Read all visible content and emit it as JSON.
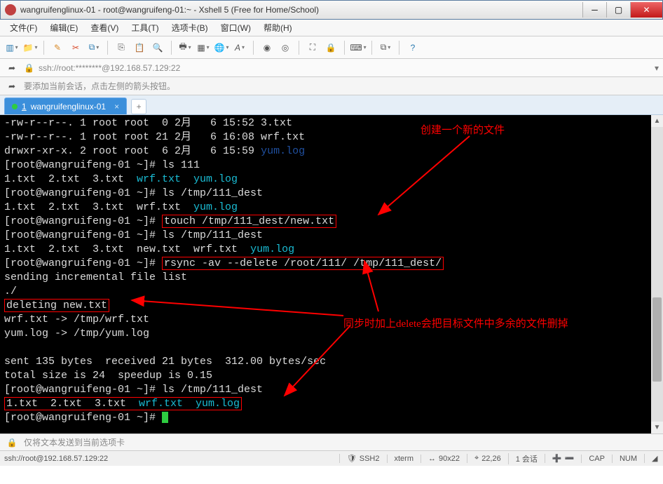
{
  "window": {
    "title": "wangruifenglinux-01 - root@wangruifeng-01:~ - Xshell 5 (Free for Home/School)"
  },
  "menu": {
    "file": "文件(F)",
    "edit": "编辑(E)",
    "view": "查看(V)",
    "tools": "工具(T)",
    "tabs": "选项卡(B)",
    "window": "窗口(W)",
    "help": "帮助(H)"
  },
  "address": {
    "url": "ssh://root:********@192.168.57.129:22"
  },
  "hint": {
    "text": "要添加当前会话，点击左侧的箭头按钮。"
  },
  "tab": {
    "index": "1",
    "label": "wangruifenglinux-01"
  },
  "terminal_lines": [
    {
      "segs": [
        {
          "t": "-rw-r--r--. 1 root root  0 2月   6 15:52 3.txt"
        }
      ]
    },
    {
      "segs": [
        {
          "t": "-rw-r--r--. 1 root root 21 2月   6 16:08 wrf.txt"
        }
      ]
    },
    {
      "segs": [
        {
          "t": "drwxr-xr-x. 2 root root  6 2月   6 15:59 "
        },
        {
          "t": "yum.log",
          "cls": "darkblue"
        }
      ]
    },
    {
      "segs": [
        {
          "t": "[root@wangruifeng-01 ~]# ls 111"
        }
      ]
    },
    {
      "segs": [
        {
          "t": "1.txt  2.txt  3.txt  "
        },
        {
          "t": "wrf.txt  yum.log",
          "cls": "cyan"
        }
      ]
    },
    {
      "segs": [
        {
          "t": "[root@wangruifeng-01 ~]# ls /tmp/111_dest"
        }
      ]
    },
    {
      "segs": [
        {
          "t": "1.txt  2.txt  3.txt  wrf.txt  "
        },
        {
          "t": "yum.log",
          "cls": "cyan"
        }
      ]
    },
    {
      "segs": [
        {
          "t": "[root@wangruifeng-01 ~]# "
        },
        {
          "t": "touch /tmp/111_dest/new.txt",
          "box": true
        }
      ]
    },
    {
      "segs": [
        {
          "t": "[root@wangruifeng-01 ~]# ls /tmp/111_dest"
        }
      ]
    },
    {
      "segs": [
        {
          "t": "1.txt  2.txt  3.txt  new.txt  wrf.txt  "
        },
        {
          "t": "yum.log",
          "cls": "cyan"
        }
      ]
    },
    {
      "segs": [
        {
          "t": "[root@wangruifeng-01 ~]# "
        },
        {
          "t": "rsync -av --delete /root/111/ /tmp/111_dest/",
          "box": true
        }
      ]
    },
    {
      "segs": [
        {
          "t": "sending incremental file list"
        }
      ]
    },
    {
      "segs": [
        {
          "t": "./"
        }
      ]
    },
    {
      "segs": [
        {
          "t": "deleting new.txt",
          "box": true
        }
      ]
    },
    {
      "segs": [
        {
          "t": "wrf.txt -> /tmp/wrf.txt"
        }
      ]
    },
    {
      "segs": [
        {
          "t": "yum.log -> /tmp/yum.log"
        }
      ]
    },
    {
      "segs": [
        {
          "t": " "
        }
      ]
    },
    {
      "segs": [
        {
          "t": "sent 135 bytes  received 21 bytes  312.00 bytes/sec"
        }
      ]
    },
    {
      "segs": [
        {
          "t": "total size is 24  speedup is 0.15"
        }
      ]
    },
    {
      "segs": [
        {
          "t": "[root@wangruifeng-01 ~]# ls /tmp/111_dest"
        }
      ]
    },
    {
      "segs": [
        {
          "t": "1.txt  2.txt  3.txt  ",
          "box": true
        },
        {
          "t": "wrf.txt  yum.log",
          "cls": "cyan",
          "box": true
        }
      ]
    },
    {
      "segs": [
        {
          "t": "[root@wangruifeng-01 ~]# "
        },
        {
          "cursor": true
        }
      ]
    }
  ],
  "annotations": {
    "a1": "创建一个新的文件",
    "a2": "同步时加上delete会把目标文件中多余的文件删掉"
  },
  "footer": {
    "note": "仅将文本发送到当前选项卡"
  },
  "status": {
    "conn": "ssh://root@192.168.57.129:22",
    "proto": "SSH2",
    "term": "xterm",
    "size": "90x22",
    "pos": "22,26",
    "sess": "1 会话",
    "caps": "CAP",
    "num": "NUM"
  }
}
